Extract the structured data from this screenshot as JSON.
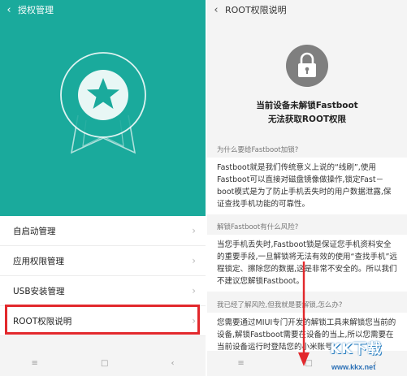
{
  "left": {
    "back_icon": "‹",
    "title": "授权管理",
    "badge_icon": "star-ribbon-badge",
    "menu": [
      {
        "label": "自启动管理"
      },
      {
        "label": "应用权限管理"
      },
      {
        "label": "USB安装管理"
      },
      {
        "label": "ROOT权限说明"
      }
    ],
    "chevron": "›",
    "highlight_color": "#e2282c",
    "nav": {
      "menu": "≡",
      "home": "□",
      "back": "‹"
    }
  },
  "right": {
    "back_icon": "‹",
    "title": "ROOT权限说明",
    "status_line1": "当前设备未解锁Fastboot",
    "status_line2": "无法获取ROOT权限",
    "sections": [
      {
        "question": "为什么要给Fastboot加锁?",
        "answer": "Fastboot就是我们传统意义上说的“线刷”,使用Fastboot可以直接对磁盘镜像做操作,锁定Fast－boot模式是为了防止手机丢失时的用户数据泄露,保证查找手机功能的可靠性。"
      },
      {
        "question": "解锁Fastboot有什么风险?",
        "answer": "当您手机丢失时,Fastboot锁是保证您手机资料安全的重要手段,一旦解锁将无法有效的使用“查找手机”远程锁定、擦除您的数据,这是非常不安全的。所以我们不建议您解锁Fastboot。"
      },
      {
        "question": "我已经了解风险,但我就是要解锁,怎么办?",
        "answer": "您需要通过MIUI专门开发的解锁工具来解锁您当前的设备,解锁Fastboot需要在设备的当上,所以您需要在当前设备运行时登陆您的小米账号"
      }
    ],
    "nav": {
      "menu": "≡",
      "home": "□",
      "back": "‹"
    }
  },
  "accent_teal": "#1aaa9c",
  "arrow_color": "#e2282c",
  "watermark": {
    "logo": "KK下载",
    "url": "www.kkx.net"
  }
}
